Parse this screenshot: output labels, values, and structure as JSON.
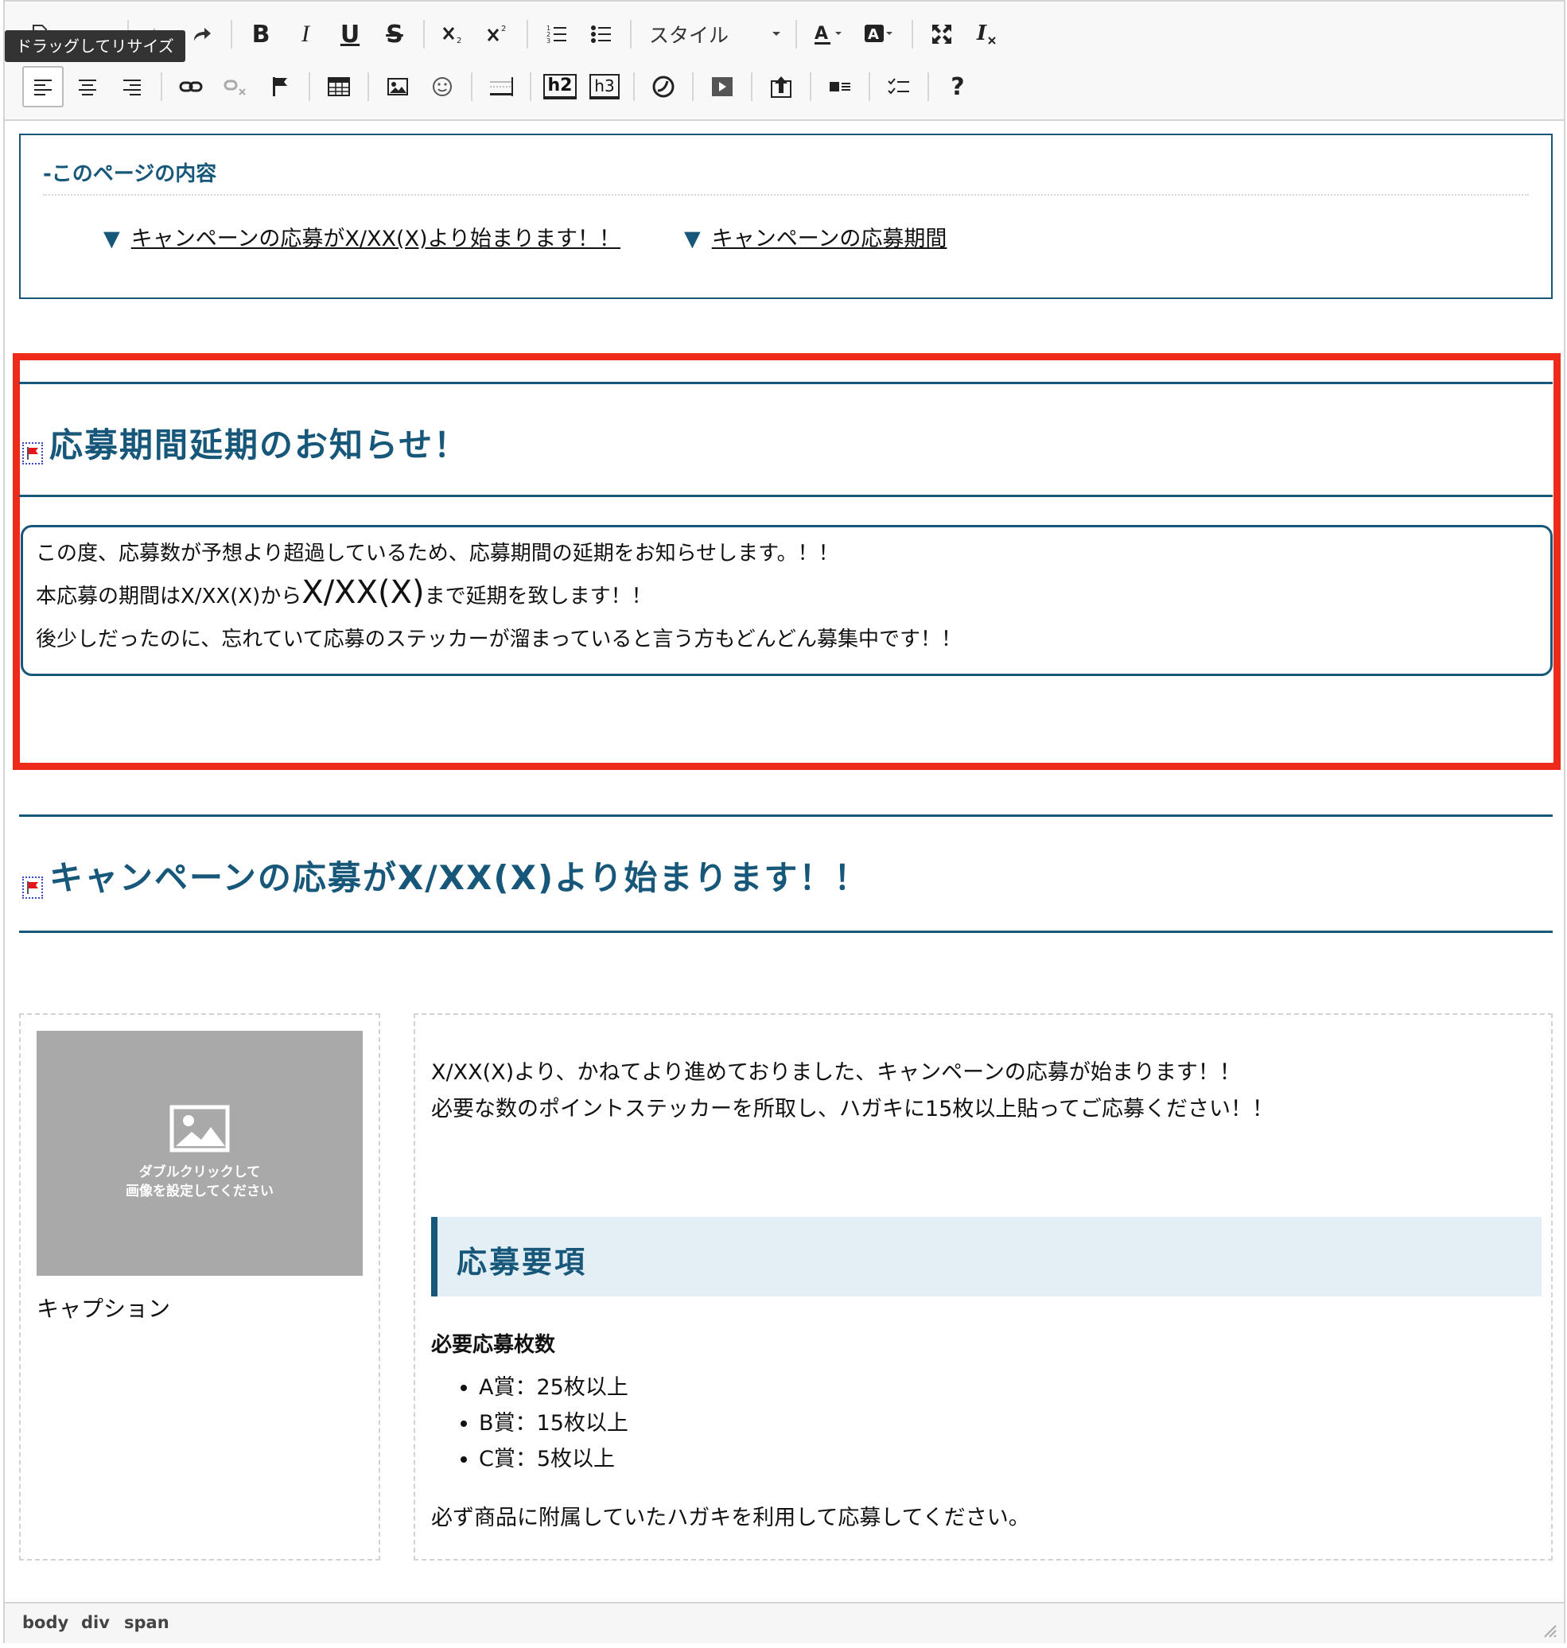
{
  "toolbar": {
    "tooltip": "ドラッグしてリサイズ",
    "style_combo_label": "スタイル",
    "h2_label": "h2",
    "h3_label": "h3",
    "bold": "B",
    "italic": "I",
    "underline": "U",
    "strike": "S",
    "help": "?"
  },
  "toc": {
    "title": "-このページの内容",
    "marker": "▼",
    "links": [
      "キャンペーンの応募がX/XX(X)より始まります！！",
      "キャンペーンの応募期間"
    ]
  },
  "notice": {
    "heading": "応募期間延期のお知らせ！",
    "line1": "この度、応募数が予想より超過しているため、応募期間の延期をお知らせします。！！",
    "line2_pre": "本応募の期間はX/XX(X)から",
    "line2_big": "X/XX(X)",
    "line2_post": "まで延期を致します！！",
    "line3": "後少しだったのに、忘れていて応募のステッカーが溜まっていると言う方もどんどん募集中です！！"
  },
  "campaign": {
    "heading": "キャンペーンの応募がX/XX(X)より始まります！！",
    "image_placeholder_line1": "ダブルクリックして",
    "image_placeholder_line2": "画像を設定してください",
    "caption": "キャプション",
    "intro_line1": "X/XX(X)より、かねてより進めておりました、キャンペーンの応募が始まります！！",
    "intro_line2": "必要な数のポイントステッカーを所取し、ハガキに15枚以上貼ってご応募ください！！",
    "section_heading": "応募要項",
    "req_title": "必要応募枚数",
    "req_items": [
      "A賞：25枚以上",
      "B賞：15枚以上",
      "C賞：5枚以上"
    ],
    "note": "必ず商品に附属していたハガキを利用して応募してください。"
  },
  "statusbar": {
    "path": [
      "body",
      "div",
      "span"
    ]
  },
  "colors": {
    "accent": "#17587a",
    "highlight_border": "#ee2b1a",
    "section_bg": "#e3eef5"
  }
}
